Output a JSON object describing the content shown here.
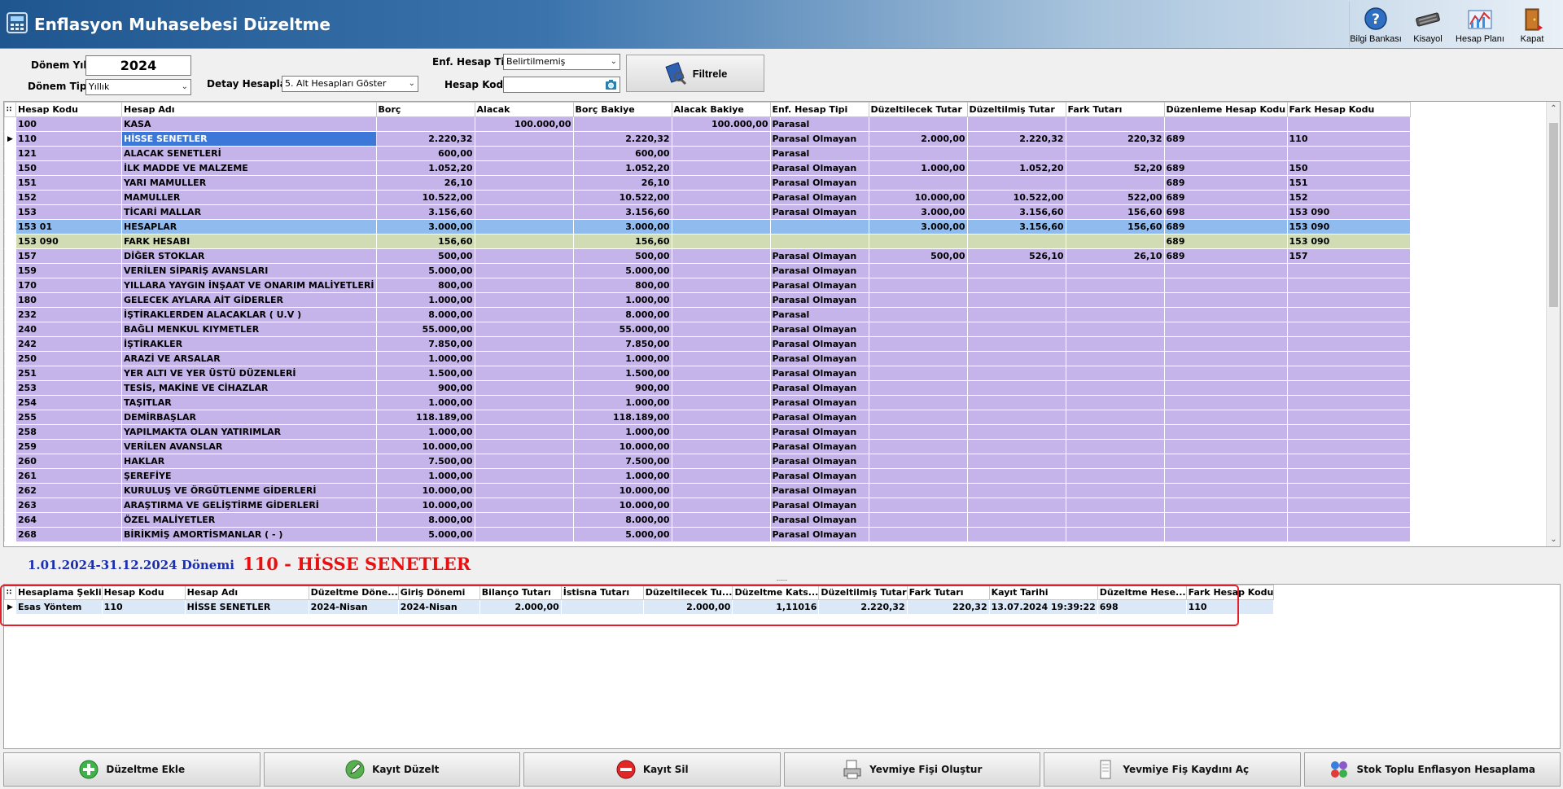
{
  "window": {
    "title": "Enflasyon Muhasebesi Düzeltme"
  },
  "toolbar": {
    "items": [
      {
        "label": "Bilgi Bankası",
        "icon": "help-icon"
      },
      {
        "label": "Kisayol",
        "icon": "keyboard-icon"
      },
      {
        "label": "Hesap Planı",
        "icon": "chart-plan-icon"
      },
      {
        "label": "Kapat",
        "icon": "door-exit-icon"
      }
    ]
  },
  "filters": {
    "donem_yili_label": "Dönem Yılı",
    "donem_yili_value": "2024",
    "donem_tipi_label": "Dönem Tipi",
    "donem_tipi_value": "Yıllık",
    "detay_hesaplar_label": "Detay Hesaplar",
    "detay_hesaplar_value": "5. Alt Hesapları Göster",
    "enf_hesap_tipi_label": "Enf. Hesap Tipi",
    "enf_hesap_tipi_value": "Belirtilmemiş",
    "hesap_kodu_label": "Hesap Kodu",
    "hesap_kodu_value": "",
    "filter_button": "Filtrele"
  },
  "main_grid": {
    "columns": [
      "Hesap Kodu",
      "Hesap Adı",
      "Borç",
      "Alacak",
      "Borç Bakiye",
      "Alacak Bakiye",
      "Enf. Hesap Tipi",
      "Düzeltilecek Tutar",
      "Düzeltilmiş Tutar",
      "Fark Tutarı",
      "Düzenleme Hesap Kodu",
      "Fark Hesap Kodu"
    ],
    "rows": [
      [
        "100",
        "KASA",
        "",
        "100.000,00",
        "",
        "100.000,00",
        "Parasal",
        "",
        "",
        "",
        "",
        ""
      ],
      [
        "110",
        "HİSSE SENETLER",
        "2.220,32",
        "",
        "2.220,32",
        "",
        "Parasal Olmayan",
        "2.000,00",
        "2.220,32",
        "220,32",
        "689",
        "110"
      ],
      [
        "121",
        "ALACAK SENETLERİ",
        "600,00",
        "",
        "600,00",
        "",
        "Parasal",
        "",
        "",
        "",
        "",
        ""
      ],
      [
        "150",
        "İLK MADDE VE MALZEME",
        "1.052,20",
        "",
        "1.052,20",
        "",
        "Parasal Olmayan",
        "1.000,00",
        "1.052,20",
        "52,20",
        "689",
        "150"
      ],
      [
        "151",
        "YARI MAMULLER",
        "26,10",
        "",
        "26,10",
        "",
        "Parasal Olmayan",
        "",
        "",
        "",
        "689",
        "151"
      ],
      [
        "152",
        "MAMULLER",
        "10.522,00",
        "",
        "10.522,00",
        "",
        "Parasal Olmayan",
        "10.000,00",
        "10.522,00",
        "522,00",
        "689",
        "152"
      ],
      [
        "153",
        "TİCARİ MALLAR",
        "3.156,60",
        "",
        "3.156,60",
        "",
        "Parasal Olmayan",
        "3.000,00",
        "3.156,60",
        "156,60",
        "698",
        "153 090"
      ],
      [
        "153 01",
        "HESAPLAR",
        "3.000,00",
        "",
        "3.000,00",
        "",
        "",
        "3.000,00",
        "3.156,60",
        "156,60",
        "689",
        "153 090"
      ],
      [
        "153 090",
        "FARK HESABI",
        "156,60",
        "",
        "156,60",
        "",
        "",
        "",
        "",
        "",
        "689",
        "153 090"
      ],
      [
        "157",
        "DİĞER STOKLAR",
        "500,00",
        "",
        "500,00",
        "",
        "Parasal Olmayan",
        "500,00",
        "526,10",
        "26,10",
        "689",
        "157"
      ],
      [
        "159",
        "VERİLEN SİPARİŞ AVANSLARI",
        "5.000,00",
        "",
        "5.000,00",
        "",
        "Parasal Olmayan",
        "",
        "",
        "",
        "",
        ""
      ],
      [
        "170",
        "YILLARA YAYGIN İNŞAAT VE ONARIM MALİYETLERİ",
        "800,00",
        "",
        "800,00",
        "",
        "Parasal Olmayan",
        "",
        "",
        "",
        "",
        ""
      ],
      [
        "180",
        "GELECEK AYLARA AİT GİDERLER",
        "1.000,00",
        "",
        "1.000,00",
        "",
        "Parasal Olmayan",
        "",
        "",
        "",
        "",
        ""
      ],
      [
        "232",
        "İŞTİRAKLERDEN ALACAKLAR  ( U.V )",
        "8.000,00",
        "",
        "8.000,00",
        "",
        "Parasal",
        "",
        "",
        "",
        "",
        ""
      ],
      [
        "240",
        "BAĞLI MENKUL KIYMETLER",
        "55.000,00",
        "",
        "55.000,00",
        "",
        "Parasal Olmayan",
        "",
        "",
        "",
        "",
        ""
      ],
      [
        "242",
        "İŞTİRAKLER",
        "7.850,00",
        "",
        "7.850,00",
        "",
        "Parasal Olmayan",
        "",
        "",
        "",
        "",
        ""
      ],
      [
        "250",
        "ARAZİ VE ARSALAR",
        "1.000,00",
        "",
        "1.000,00",
        "",
        "Parasal Olmayan",
        "",
        "",
        "",
        "",
        ""
      ],
      [
        "251",
        "YER ALTI VE YER ÜSTÜ DÜZENLERİ",
        "1.500,00",
        "",
        "1.500,00",
        "",
        "Parasal Olmayan",
        "",
        "",
        "",
        "",
        ""
      ],
      [
        "253",
        "TESİS, MAKİNE VE CİHAZLAR",
        "900,00",
        "",
        "900,00",
        "",
        "Parasal Olmayan",
        "",
        "",
        "",
        "",
        ""
      ],
      [
        "254",
        "TAŞITLAR",
        "1.000,00",
        "",
        "1.000,00",
        "",
        "Parasal Olmayan",
        "",
        "",
        "",
        "",
        ""
      ],
      [
        "255",
        "DEMİRBAŞLAR",
        "118.189,00",
        "",
        "118.189,00",
        "",
        "Parasal Olmayan",
        "",
        "",
        "",
        "",
        ""
      ],
      [
        "258",
        "YAPILMAKTA OLAN YATIRIMLAR",
        "1.000,00",
        "",
        "1.000,00",
        "",
        "Parasal Olmayan",
        "",
        "",
        "",
        "",
        ""
      ],
      [
        "259",
        "VERİLEN AVANSLAR",
        "10.000,00",
        "",
        "10.000,00",
        "",
        "Parasal Olmayan",
        "",
        "",
        "",
        "",
        ""
      ],
      [
        "260",
        "HAKLAR",
        "7.500,00",
        "",
        "7.500,00",
        "",
        "Parasal Olmayan",
        "",
        "",
        "",
        "",
        ""
      ],
      [
        "261",
        "ŞEREFİYE",
        "1.000,00",
        "",
        "1.000,00",
        "",
        "Parasal Olmayan",
        "",
        "",
        "",
        "",
        ""
      ],
      [
        "262",
        "KURULUŞ VE ÖRGÜTLENME GİDERLERİ",
        "10.000,00",
        "",
        "10.000,00",
        "",
        "Parasal Olmayan",
        "",
        "",
        "",
        "",
        ""
      ],
      [
        "263",
        "ARAŞTIRMA VE GELİŞTİRME GİDERLERİ",
        "10.000,00",
        "",
        "10.000,00",
        "",
        "Parasal Olmayan",
        "",
        "",
        "",
        "",
        ""
      ],
      [
        "264",
        "ÖZEL MALİYETLER",
        "8.000,00",
        "",
        "8.000,00",
        "",
        "Parasal Olmayan",
        "",
        "",
        "",
        "",
        ""
      ],
      [
        "268",
        "BİRİKMİŞ AMORTİSMANLAR ( - )",
        "5.000,00",
        "",
        "5.000,00",
        "",
        "Parasal Olmayan",
        "",
        "",
        "",
        "",
        ""
      ]
    ]
  },
  "period_text": "1.01.2024-31.12.2024 Dönemi",
  "selected_account_text": "110 - HİSSE SENETLER",
  "detail_grid": {
    "columns": [
      "Hesaplama Şekli",
      "Hesap Kodu",
      "Hesap Adı",
      "Düzeltme Döne...",
      "Giriş Dönemi",
      "Bilanço Tutarı",
      "İstisna Tutarı",
      "Düzeltilecek Tu...",
      "Düzeltme Kats...",
      "Düzeltilmiş Tutar",
      "Fark Tutarı",
      "Kayıt Tarihi",
      "Düzeltme Hese...",
      "Fark Hesap Kodu"
    ],
    "rows": [
      [
        "Esas Yöntem",
        "110",
        "HİSSE SENETLER",
        "2024-Nisan",
        "2024-Nisan",
        "2.000,00",
        "",
        "2.000,00",
        "1,11016",
        "2.220,32",
        "220,32",
        "13.07.2024 19:39:22",
        "698",
        "110"
      ]
    ]
  },
  "bottom_buttons": {
    "add": "Düzeltme Ekle",
    "edit": "Kayıt Düzelt",
    "delete": "Kayıt Sil",
    "create_voucher": "Yevmiye Fişi Oluştur",
    "open_voucher": "Yevmiye Fiş Kaydını Aç",
    "bulk_stock": "Stok Toplu Enflasyon Hesaplama"
  }
}
